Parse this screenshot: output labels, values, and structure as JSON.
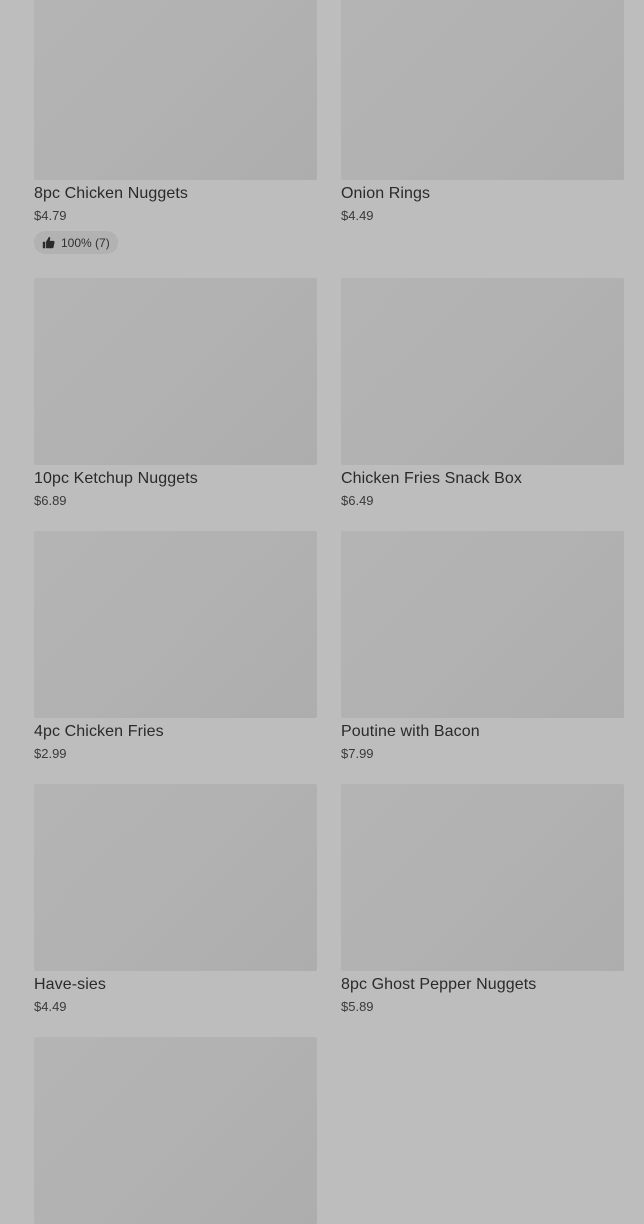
{
  "products": [
    {
      "name": "8pc Chicken Nuggets",
      "price": "$4.79",
      "rating": "100% (7)"
    },
    {
      "name": "Onion Rings",
      "price": "$4.49"
    },
    {
      "name": "10pc Ketchup Nuggets",
      "price": "$6.89"
    },
    {
      "name": "Chicken Fries Snack Box",
      "price": "$6.49"
    },
    {
      "name": "4pc Chicken Fries",
      "price": "$2.99"
    },
    {
      "name": "Poutine with Bacon",
      "price": "$7.99"
    },
    {
      "name": "Have-sies",
      "price": "$4.49"
    },
    {
      "name": "8pc Ghost Pepper Nuggets",
      "price": "$5.89"
    }
  ],
  "icons": {
    "rating": "thumbs-up-icon"
  }
}
